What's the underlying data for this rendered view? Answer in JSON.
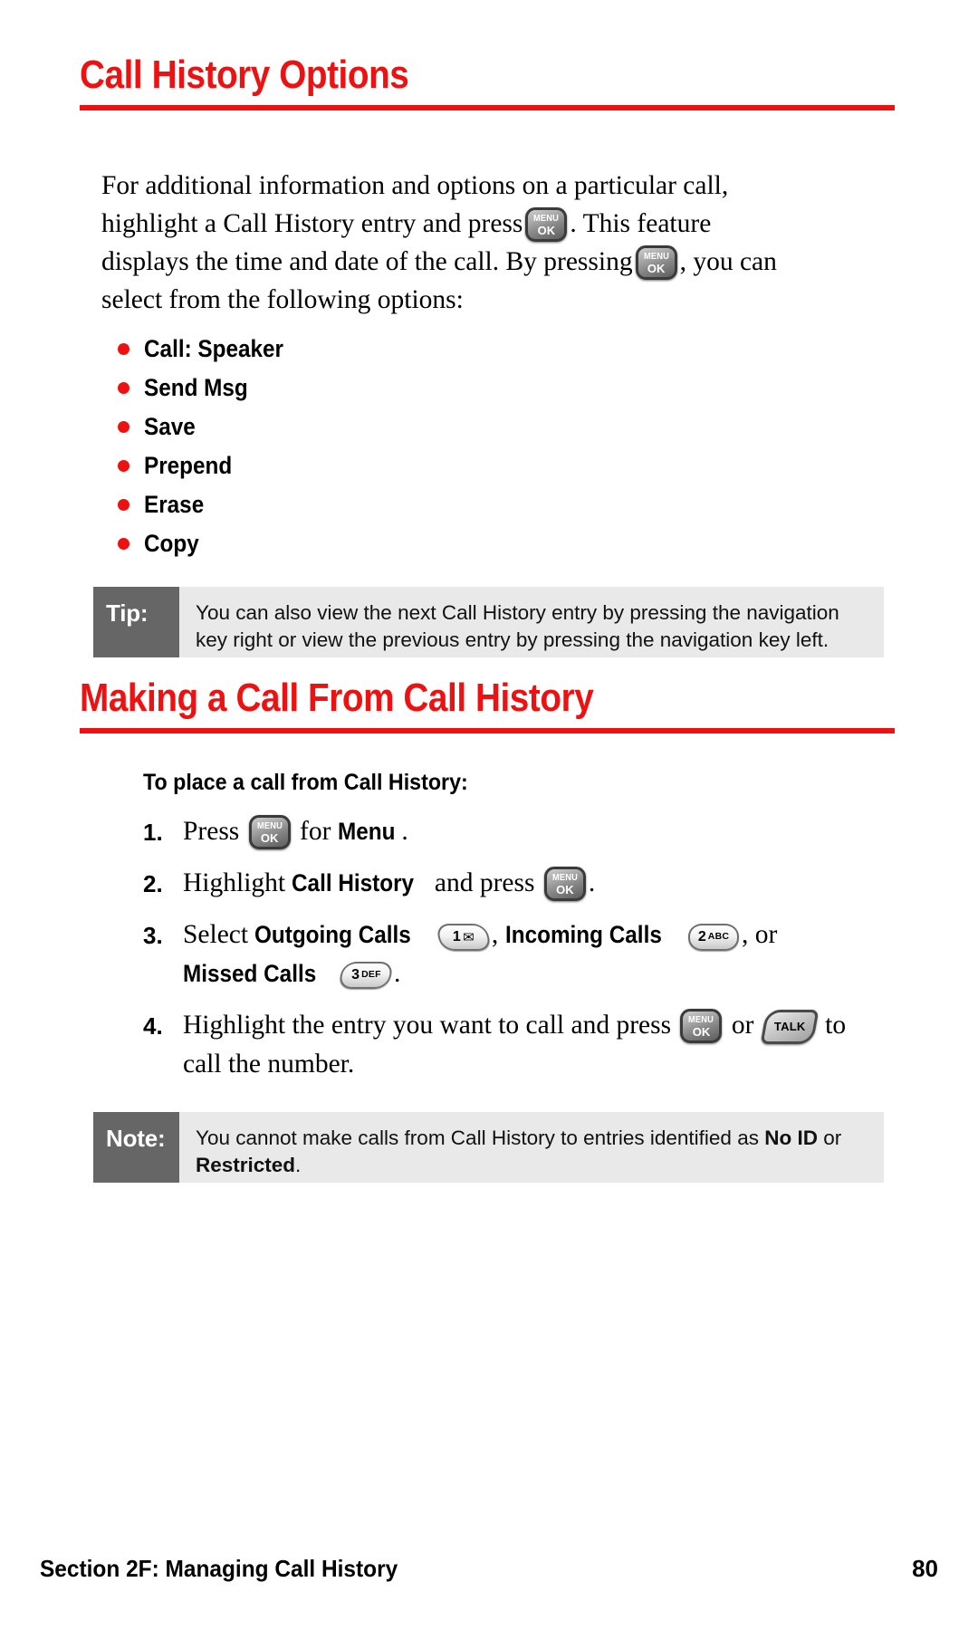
{
  "section1": {
    "heading": "Call History Options",
    "intro_1": "For additional information and options on a particular call, highlight a Call History entry and press",
    "intro_2": ". This feature displays the time and date of the call. By pressing",
    "intro_3": ", you can select from the following options:",
    "options": [
      {
        "label": "Call: Speaker"
      },
      {
        "label": "Send Msg"
      },
      {
        "label": "Save"
      },
      {
        "label": "Prepend"
      },
      {
        "label": "Erase"
      },
      {
        "label": "Copy"
      }
    ],
    "tip": {
      "label": "Tip:",
      "text": "You can also view the next Call History entry by pressing the navigation key right or view the previous entry by pressing the navigation key left."
    }
  },
  "section2": {
    "heading": "Making a Call From Call History",
    "procedure_title": "To place a call from Call History:",
    "steps": [
      {
        "num": "1.",
        "parts": [
          "Press",
          "for",
          "Menu",
          "."
        ]
      },
      {
        "num": "2.",
        "parts": [
          "Highlight",
          "Call History",
          "and press",
          "."
        ]
      },
      {
        "num": "3.",
        "parts": [
          "Select",
          "Outgoing Calls",
          ",",
          "Incoming Calls",
          ", or",
          "Missed Calls",
          "."
        ]
      },
      {
        "num": "4.",
        "parts": [
          "Highlight the entry you want to call and press",
          "or",
          "to call the number."
        ]
      }
    ],
    "note": {
      "label": "Note:",
      "text_1": "You cannot make calls from Call History to entries identified as ",
      "bold_1": "No ID",
      "text_2": " or ",
      "bold_2": "Restricted",
      "text_3": "."
    }
  },
  "keys": {
    "menu_ok": {
      "line1": "MENU",
      "line2": "OK"
    },
    "key1": {
      "digit": "1",
      "glyph": "✉",
      "name": "one-envelope-key"
    },
    "key2": {
      "digit": "2",
      "letters": "ABC"
    },
    "key3": {
      "digit": "3",
      "letters": "DEF"
    },
    "talk": {
      "label": "TALK"
    }
  },
  "footer": {
    "section": "Section 2F: Managing Call History",
    "page": "80"
  },
  "colors": {
    "accent_red": "#ee1111",
    "callout_label_bg": "#666666",
    "callout_body_bg": "#e9e9e9"
  }
}
